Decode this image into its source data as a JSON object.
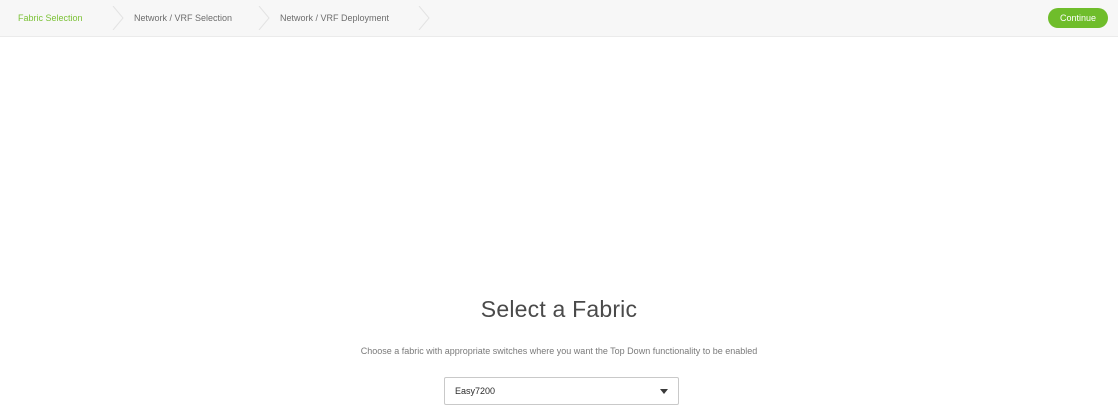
{
  "wizard": {
    "steps": [
      {
        "label": "Fabric Selection",
        "state": "active"
      },
      {
        "label": "Network / VRF Selection",
        "state": "pending"
      },
      {
        "label": "Network / VRF Deployment",
        "state": "pending"
      }
    ],
    "continue_label": "Continue"
  },
  "main": {
    "title": "Select a Fabric",
    "subtitle": "Choose a fabric with appropriate switches where you want the Top Down functionality to be enabled",
    "fabric_select": {
      "value": "Easy7200"
    }
  },
  "colors": {
    "accent": "#6fbd2b",
    "active_step_text": "#7cc237",
    "topbar_bg": "#f7f7f7"
  },
  "icons": {
    "step_separator": "chevron-right-icon",
    "dropdown": "caret-down-icon"
  }
}
